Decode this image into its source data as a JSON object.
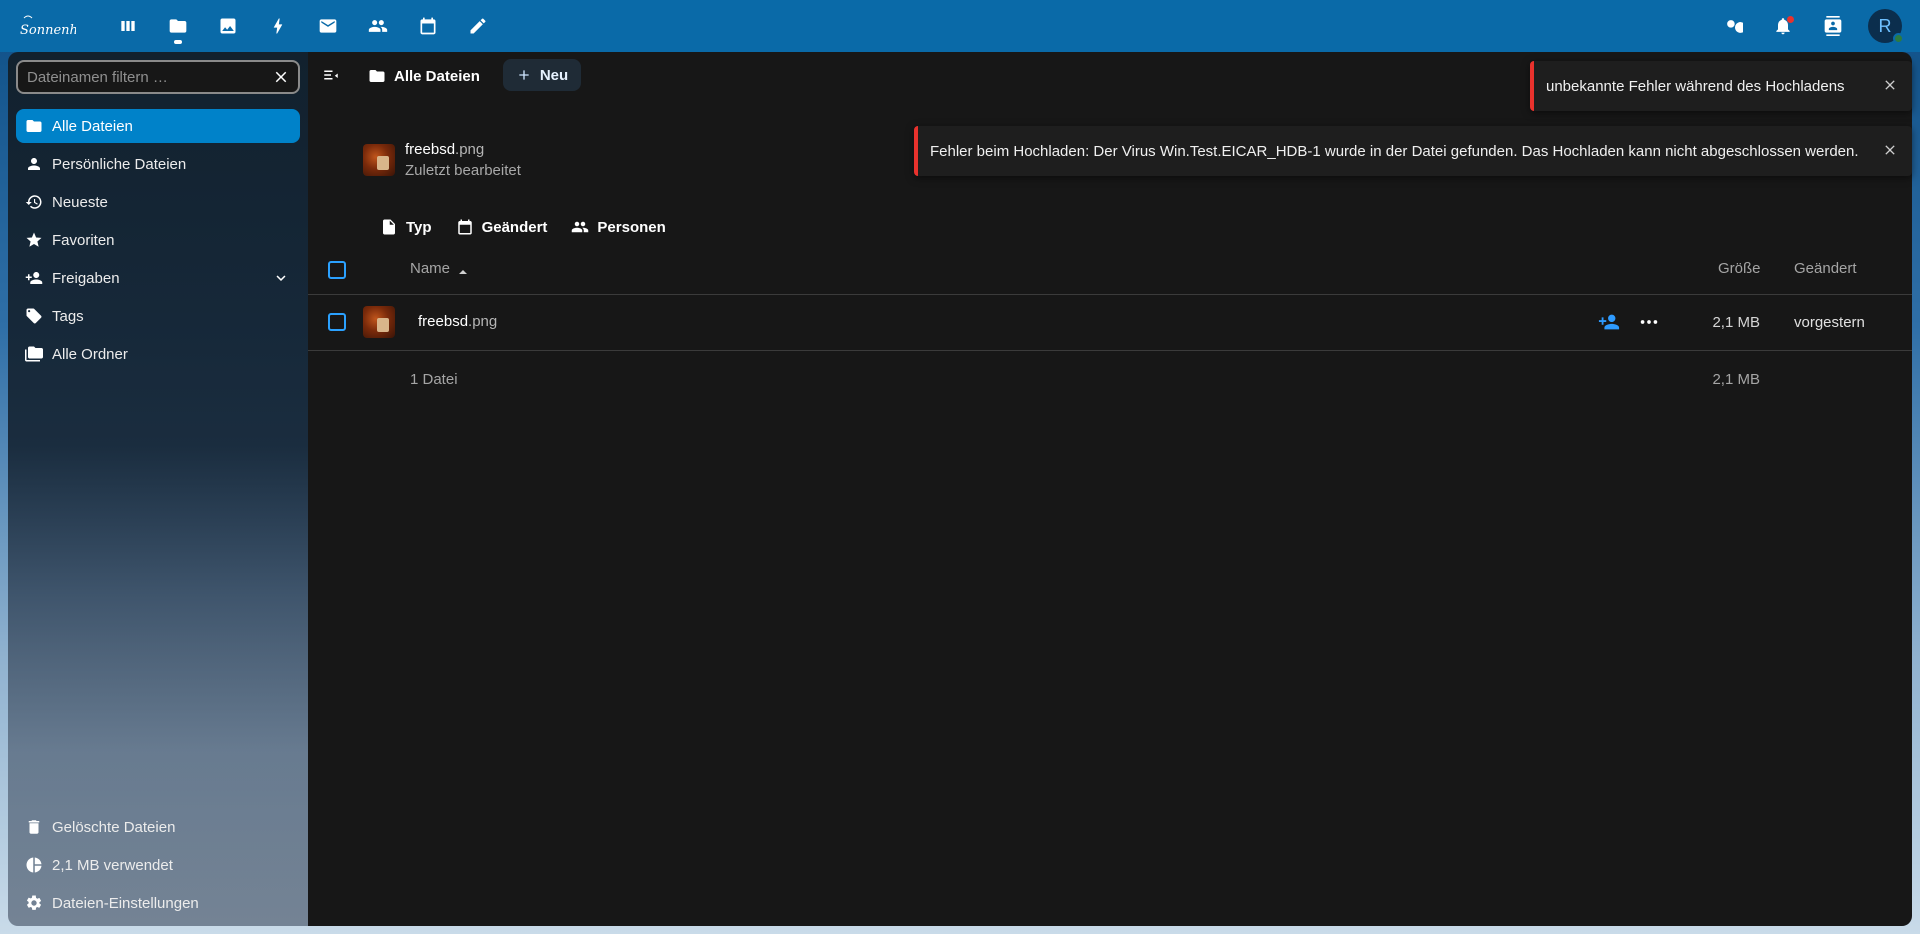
{
  "header": {
    "logo_text": "Sonnenhof",
    "apps": [
      {
        "name": "dashboard",
        "icon": "dashboard-icon"
      },
      {
        "name": "files",
        "icon": "folder-icon",
        "active": true
      },
      {
        "name": "photos",
        "icon": "image-icon"
      },
      {
        "name": "activity",
        "icon": "lightning-icon"
      },
      {
        "name": "mail",
        "icon": "mail-icon"
      },
      {
        "name": "contacts",
        "icon": "contacts-icon"
      },
      {
        "name": "calendar",
        "icon": "calendar-icon"
      },
      {
        "name": "notes",
        "icon": "pencil-icon"
      }
    ],
    "avatar_letter": "R"
  },
  "sidebar": {
    "filter_placeholder": "Dateinamen filtern …",
    "items": [
      {
        "label": "Alle Dateien",
        "icon": "folder-icon",
        "active": true
      },
      {
        "label": "Persönliche Dateien",
        "icon": "account-icon"
      },
      {
        "label": "Neueste",
        "icon": "history-icon"
      },
      {
        "label": "Favoriten",
        "icon": "star-icon"
      },
      {
        "label": "Freigaben",
        "icon": "share-icon"
      },
      {
        "label": "Tags",
        "icon": "tag-icon"
      },
      {
        "label": "Alle Ordner",
        "icon": "folder-multiple-icon"
      }
    ],
    "bottom": [
      {
        "label": "Gelöschte Dateien",
        "icon": "trash-icon"
      },
      {
        "label": "2,1 MB verwendet",
        "icon": "pie-chart-icon"
      },
      {
        "label": "Dateien-Einstellungen",
        "icon": "gear-icon"
      }
    ]
  },
  "toolbar": {
    "breadcrumb": "Alle Dateien",
    "new_label": "Neu"
  },
  "recent": {
    "name": "freebsd",
    "ext": ".png",
    "subtitle": "Zuletzt bearbeitet"
  },
  "filters": [
    {
      "label": "Typ",
      "icon": "file-icon"
    },
    {
      "label": "Geändert",
      "icon": "calendar-icon"
    },
    {
      "label": "Personen",
      "icon": "people-icon"
    }
  ],
  "table": {
    "columns": {
      "name": "Name",
      "size": "Größe",
      "modified": "Geändert"
    },
    "rows": [
      {
        "name": "freebsd",
        "ext": ".png",
        "size": "2,1 MB",
        "modified": "vorgestern"
      }
    ],
    "summary": {
      "count": "1 Datei",
      "size": "2,1 MB"
    }
  },
  "toasts": [
    {
      "text": "unbekannte Fehler während des Hochladens"
    },
    {
      "text": "Fehler beim Hochladen: Der Virus Win.Test.EICAR_HDB-1 wurde in der Datei gefunden. Das Hochladen kann nicht abgeschlossen werden."
    }
  ],
  "colors": {
    "header_bg": "#0a6aa8",
    "accent": "#0082c9",
    "content_bg": "#171717",
    "error": "#e9322d"
  }
}
